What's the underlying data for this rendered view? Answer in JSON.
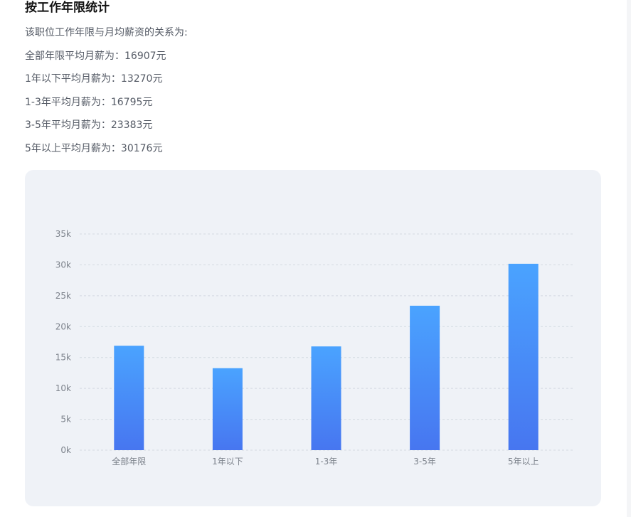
{
  "section": {
    "title": "按工作年限统计",
    "intro": "该职位工作年限与月均薪资的关系为:",
    "lines": [
      "全部年限平均月薪为：16907元",
      "1年以下平均月薪为：13270元",
      "1-3年平均月薪为：16795元",
      "3-5年平均月薪为：23383元",
      "5年以上平均月薪为：30176元"
    ]
  },
  "chart_data": {
    "type": "bar",
    "categories": [
      "全部年限",
      "1年以下",
      "1-3年",
      "3-5年",
      "5年以上"
    ],
    "values": [
      16907,
      13270,
      16795,
      23383,
      30176
    ],
    "ylim": [
      0,
      35000
    ],
    "yticks": [
      0,
      5000,
      10000,
      15000,
      20000,
      25000,
      30000,
      35000
    ],
    "ytick_labels": [
      "0k",
      "5k",
      "10k",
      "15k",
      "20k",
      "25k",
      "30k",
      "35k"
    ],
    "grid": true,
    "bar_color_top": "#4aa3ff",
    "bar_color_bottom": "#4776f0",
    "grid_color": "#d4d9e1"
  }
}
